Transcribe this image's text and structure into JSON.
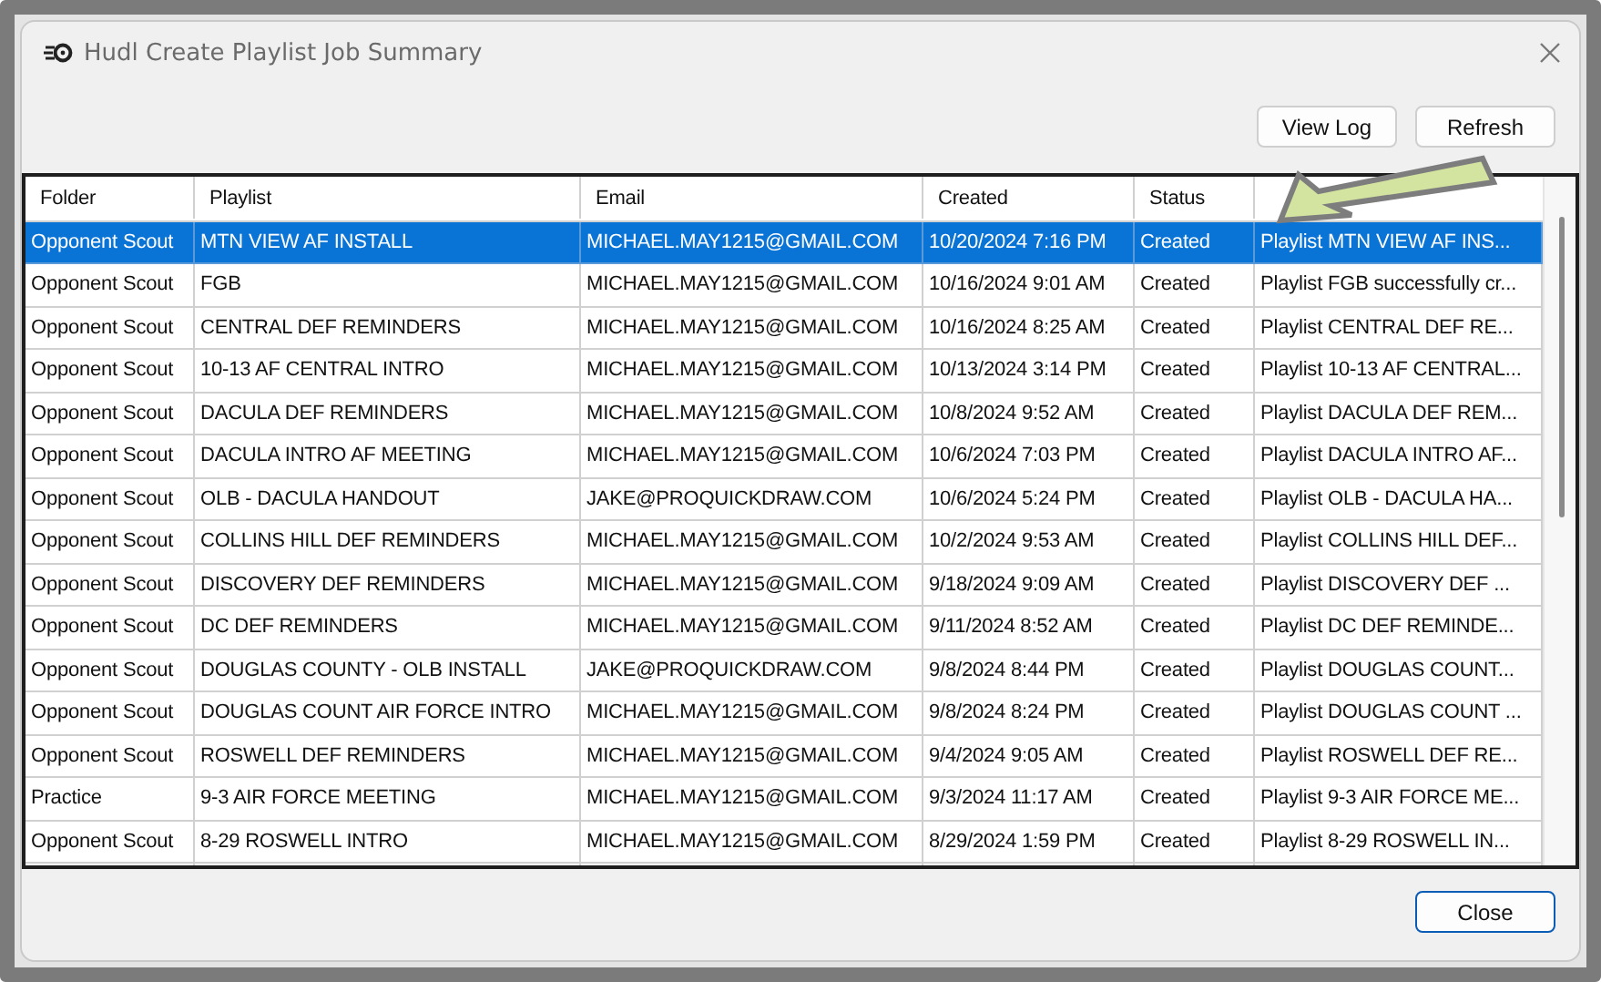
{
  "window": {
    "title": "Hudl Create Playlist Job Summary"
  },
  "toolbar": {
    "buttons": [
      "View Log",
      "Refresh"
    ]
  },
  "table": {
    "columns": [
      "Folder",
      "Playlist",
      "Email",
      "Created",
      "Status"
    ],
    "rows": [
      {
        "selected": true,
        "cells": [
          "Opponent Scout",
          "MTN VIEW AF INSTALL",
          "MICHAEL.MAY1215@GMAIL.COM",
          "10/20/2024 7:16 PM",
          "Created",
          "Playlist MTN VIEW AF INS..."
        ]
      },
      {
        "selected": false,
        "cells": [
          "Opponent Scout",
          "FGB",
          "MICHAEL.MAY1215@GMAIL.COM",
          "10/16/2024 9:01 AM",
          "Created",
          "Playlist FGB successfully cr..."
        ]
      },
      {
        "selected": false,
        "cells": [
          "Opponent Scout",
          "CENTRAL DEF REMINDERS",
          "MICHAEL.MAY1215@GMAIL.COM",
          "10/16/2024 8:25 AM",
          "Created",
          "Playlist CENTRAL DEF RE..."
        ]
      },
      {
        "selected": false,
        "cells": [
          "Opponent Scout",
          "10-13 AF CENTRAL INTRO",
          "MICHAEL.MAY1215@GMAIL.COM",
          "10/13/2024 3:14 PM",
          "Created",
          "Playlist 10-13 AF CENTRAL..."
        ]
      },
      {
        "selected": false,
        "cells": [
          "Opponent Scout",
          "DACULA DEF REMINDERS",
          "MICHAEL.MAY1215@GMAIL.COM",
          "10/8/2024 9:52 AM",
          "Created",
          "Playlist DACULA DEF REM..."
        ]
      },
      {
        "selected": false,
        "cells": [
          "Opponent Scout",
          "DACULA INTRO AF MEETING",
          "MICHAEL.MAY1215@GMAIL.COM",
          "10/6/2024 7:03 PM",
          "Created",
          "Playlist DACULA INTRO AF..."
        ]
      },
      {
        "selected": false,
        "cells": [
          "Opponent Scout",
          "OLB - DACULA HANDOUT",
          "JAKE@PROQUICKDRAW.COM",
          "10/6/2024 5:24 PM",
          "Created",
          "Playlist OLB - DACULA HA..."
        ]
      },
      {
        "selected": false,
        "cells": [
          "Opponent Scout",
          "COLLINS HILL DEF REMINDERS",
          "MICHAEL.MAY1215@GMAIL.COM",
          "10/2/2024 9:53 AM",
          "Created",
          "Playlist COLLINS HILL DEF..."
        ]
      },
      {
        "selected": false,
        "cells": [
          "Opponent Scout",
          "DISCOVERY DEF REMINDERS",
          "MICHAEL.MAY1215@GMAIL.COM",
          "9/18/2024 9:09 AM",
          "Created",
          "Playlist DISCOVERY DEF ..."
        ]
      },
      {
        "selected": false,
        "cells": [
          "Opponent Scout",
          "DC DEF REMINDERS",
          "MICHAEL.MAY1215@GMAIL.COM",
          "9/11/2024 8:52 AM",
          "Created",
          "Playlist DC DEF REMINDE..."
        ]
      },
      {
        "selected": false,
        "cells": [
          "Opponent Scout",
          "DOUGLAS COUNTY - OLB INSTALL",
          "JAKE@PROQUICKDRAW.COM",
          "9/8/2024 8:44 PM",
          "Created",
          "Playlist DOUGLAS COUNT..."
        ]
      },
      {
        "selected": false,
        "cells": [
          "Opponent Scout",
          "DOUGLAS COUNT AIR FORCE INTRO",
          "MICHAEL.MAY1215@GMAIL.COM",
          "9/8/2024 8:24 PM",
          "Created",
          "Playlist DOUGLAS COUNT ..."
        ]
      },
      {
        "selected": false,
        "cells": [
          "Opponent Scout",
          "ROSWELL DEF REMINDERS",
          "MICHAEL.MAY1215@GMAIL.COM",
          "9/4/2024 9:05 AM",
          "Created",
          "Playlist ROSWELL DEF RE..."
        ]
      },
      {
        "selected": false,
        "cells": [
          "Practice",
          "9-3 AIR FORCE MEETING",
          "MICHAEL.MAY1215@GMAIL.COM",
          "9/3/2024 11:17 AM",
          "Created",
          "Playlist 9-3 AIR FORCE ME..."
        ]
      },
      {
        "selected": false,
        "cells": [
          "Opponent Scout",
          "8-29 ROSWELL INTRO",
          "MICHAEL.MAY1215@GMAIL.COM",
          "8/29/2024 1:59 PM",
          "Created",
          "Playlist 8-29 ROSWELL IN..."
        ]
      }
    ]
  },
  "footer": {
    "buttons": [
      "Close"
    ]
  }
}
